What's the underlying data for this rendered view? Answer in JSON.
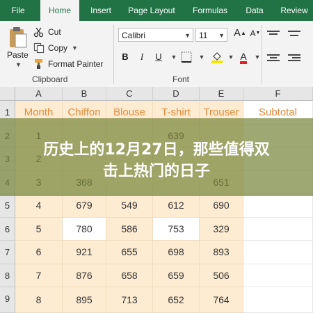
{
  "tabs": [
    "File",
    "Home",
    "Insert",
    "Page Layout",
    "Formulas",
    "Data",
    "Review"
  ],
  "clipboard": {
    "paste_label": "Paste",
    "cut_label": "Cut",
    "copy_label": "Copy",
    "format_painter_label": "Format Painter",
    "group_label": "Clipboard"
  },
  "font": {
    "font_name": "Calibri",
    "font_size": "11",
    "bold": "B",
    "italic": "I",
    "underline": "U",
    "grow": "A",
    "shrink": "A",
    "font_color_glyph": "A",
    "group_label": "Font"
  },
  "colors": {
    "ribbon_green": "#217346",
    "header_text": "#e48a3d",
    "cell_fill": "#fdecd2",
    "font_color_red": "#e02020",
    "highlight_yellow": "#f5e400"
  },
  "sheet": {
    "columns": [
      "A",
      "B",
      "C",
      "D",
      "E",
      "F"
    ],
    "row_numbers": [
      "1",
      "2",
      "3",
      "4",
      "5",
      "6",
      "7",
      "8",
      "9"
    ],
    "headers": [
      "Month",
      "Chiffon",
      "Blouse",
      "T-shirt",
      "Trouser",
      "Subtotal"
    ],
    "rows": [
      [
        "1",
        "",
        "",
        "639",
        "",
        ""
      ],
      [
        "2",
        "",
        "",
        "",
        "",
        ""
      ],
      [
        "3",
        "368",
        "",
        "",
        "651",
        ""
      ],
      [
        "4",
        "679",
        "549",
        "612",
        "690",
        ""
      ],
      [
        "5",
        "780",
        "586",
        "753",
        "329",
        ""
      ],
      [
        "6",
        "921",
        "655",
        "698",
        "893",
        ""
      ],
      [
        "7",
        "876",
        "658",
        "659",
        "506",
        ""
      ],
      [
        "8",
        "895",
        "713",
        "652",
        "764",
        ""
      ]
    ]
  },
  "overlay": {
    "line1": "历史上的12月27日，那些值得双",
    "line2": "击上热门的日子"
  }
}
